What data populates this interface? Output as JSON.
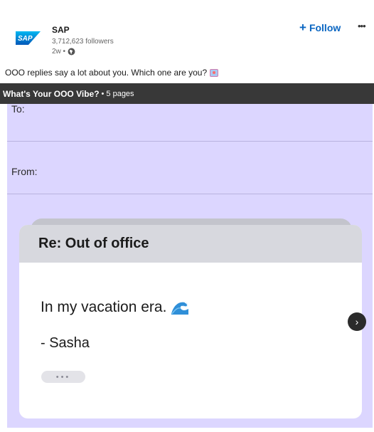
{
  "post": {
    "author": "SAP",
    "followers": "3,712,623 followers",
    "age": "2w •",
    "follow_label": "Follow",
    "follow_plus": "+",
    "more_label": "•••",
    "text": "OOO replies say a lot about you. Which one are you?",
    "emoji_icon": "postcard-emoji-icon"
  },
  "document": {
    "title": "What's Your OOO Vibe?",
    "separator": "•",
    "pages": "5 pages",
    "to_label": "To:",
    "from_label": "From:",
    "card": {
      "subject": "Re: Out of office",
      "line1": "In my vacation era.",
      "line1_icon": "wave-emoji-icon",
      "line2": "- Sasha",
      "dots": "•••"
    },
    "next_label": "›"
  },
  "colors": {
    "accent": "#0a66c2",
    "doc_bar": "#383838",
    "doc_background": "#dcd6ff",
    "card_header": "#d7d8de"
  }
}
